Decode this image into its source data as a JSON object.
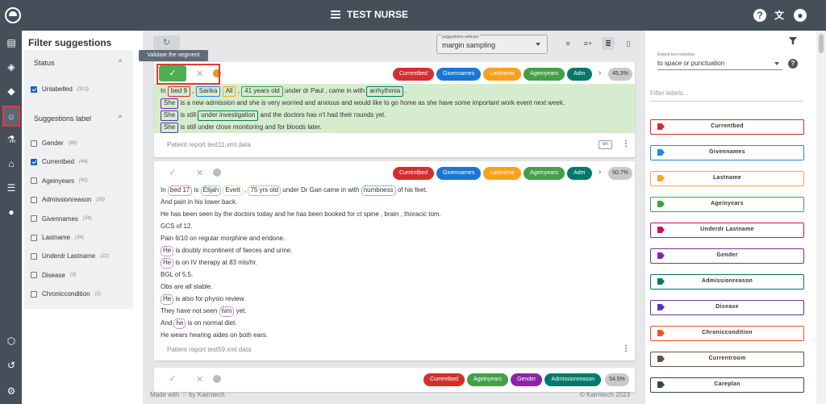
{
  "app": {
    "title": "TEST NURSE"
  },
  "filter": {
    "title": "Filter suggestions",
    "status_heading": "Status",
    "status_items": [
      {
        "label": "Unlabelled",
        "count": "(313)",
        "checked": true
      }
    ],
    "labels_heading": "Suggestions label",
    "label_items": [
      {
        "label": "Gender",
        "count": "(95)",
        "checked": false
      },
      {
        "label": "Currentbed",
        "count": "(44)",
        "checked": true
      },
      {
        "label": "Ageinyears",
        "count": "(40)",
        "checked": false
      },
      {
        "label": "Admissionreason",
        "count": "(39)",
        "checked": false
      },
      {
        "label": "Givennames",
        "count": "(34)",
        "checked": false
      },
      {
        "label": "Lastname",
        "count": "(34)",
        "checked": false
      },
      {
        "label": "Underdr Lastname",
        "count": "(22)",
        "checked": false
      },
      {
        "label": "Disease",
        "count": "(3)",
        "checked": false
      },
      {
        "label": "Chroniccondition",
        "count": "(2)",
        "checked": false
      }
    ]
  },
  "toolbar": {
    "selector_label": "suggestions selector",
    "selector_value": "margin sampling",
    "tooltip": "Validate the segment"
  },
  "cards": [
    {
      "chips": [
        {
          "label": "Currentbed",
          "color": "#d32f2f"
        },
        {
          "label": "Givennames",
          "color": "#1976d2"
        },
        {
          "label": "Lastname",
          "color": "#f9a11b"
        },
        {
          "label": "Ageinyears",
          "color": "#43a047"
        },
        {
          "label": "Adm",
          "color": "#00796b"
        }
      ],
      "score": "45.3%",
      "text": {
        "t0": "In",
        "e_bed": "bed 9",
        "t1": ",",
        "e_sarika": "Sarika",
        "e_all": "All",
        "e_age": "41 years old",
        "t2": "under dr Paul , came in with",
        "e_arr": "arrhythmia",
        "t3": ".",
        "e_she1": "She",
        "t4": "is a new admission and she is very worried and anxious and would like to go home as she have some important work event next week.",
        "e_she2": "She",
        "t5": "is still",
        "e_under": "under investigation",
        "t6": "and the doctors has n't had their rounds yet.",
        "e_she3": "She",
        "t7": "is still under close monitoring and for bloods later."
      },
      "footer": "Patient report test11.xml.data",
      "lang": "en"
    },
    {
      "chips": [
        {
          "label": "Currentbed",
          "color": "#d32f2f"
        },
        {
          "label": "Givennames",
          "color": "#1976d2"
        },
        {
          "label": "Lastname",
          "color": "#f9a11b"
        },
        {
          "label": "Ageinyears",
          "color": "#43a047"
        },
        {
          "label": "Adm",
          "color": "#00796b"
        }
      ],
      "score": "50.7%",
      "text": {
        "t0": "In",
        "s_bed": "bed 17",
        "t1": "is",
        "s_elijah": "Elijah",
        "s_evett": "Evett",
        "t2": ",",
        "s_age": "75 yrs old",
        "t3": "under Dr Gan came in with",
        "s_numb": "numbness",
        "t4": "of his feet.",
        "l2": "And pain in his lower back.",
        "l3": "He has been seen by the doctors today and he has been booked for ct spine , brain , thoracic tom.",
        "l4": "GCS of 12.",
        "l5": "Pain 6/10 on regular morphine and endone.",
        "s_he1": "He",
        "l6": "is doubly incontinent of faeces and urine.",
        "s_he2": "He",
        "l7": "is on IV therapy at 83 mls/hr.",
        "l8": "BGL of 5.5.",
        "l9": "Obs are all stable.",
        "s_he3": "He",
        "l10": "is also for physio review.",
        "l11a": "They have not seen",
        "s_him": "him",
        "l11b": "yet.",
        "l12a": "And",
        "s_he4": "he",
        "l12b": "is on normal diet.",
        "l13": "He wears hearing aides on both ears."
      },
      "footer": "Patient report test59.xml.data"
    },
    {
      "chips": [
        {
          "label": "Currentbed",
          "color": "#d32f2f"
        },
        {
          "label": "Ageinyears",
          "color": "#43a047"
        },
        {
          "label": "Gender",
          "color": "#8e24aa"
        },
        {
          "label": "Admissionreason",
          "color": "#00796b"
        }
      ],
      "score": "54.5%"
    }
  ],
  "footer": {
    "made": "Made with ♡ by Kairntech",
    "copy": "©   Kairntech 2023"
  },
  "right": {
    "extend_label": "Extend text selection",
    "extend_value": "to space or punctuation",
    "filter_placeholder": "Filter labels...",
    "labels": [
      {
        "label": "Currentbed",
        "color": "#d32f2f"
      },
      {
        "label": "Givennames",
        "color": "#1e88e5"
      },
      {
        "label": "Lastname",
        "color": "#f9a825"
      },
      {
        "label": "Ageinyears",
        "color": "#43a047"
      },
      {
        "label": "Underdr Lastname",
        "color": "#c2185b"
      },
      {
        "label": "Gender",
        "color": "#8e24aa"
      },
      {
        "label": "Admissionreason",
        "color": "#00796b"
      },
      {
        "label": "Disease",
        "color": "#5e35b1"
      },
      {
        "label": "Chroniccondition",
        "color": "#f4511e"
      },
      {
        "label": "Currentroom",
        "color": "#6d4c41"
      },
      {
        "label": "Careplan",
        "color": "#37474f"
      }
    ]
  }
}
